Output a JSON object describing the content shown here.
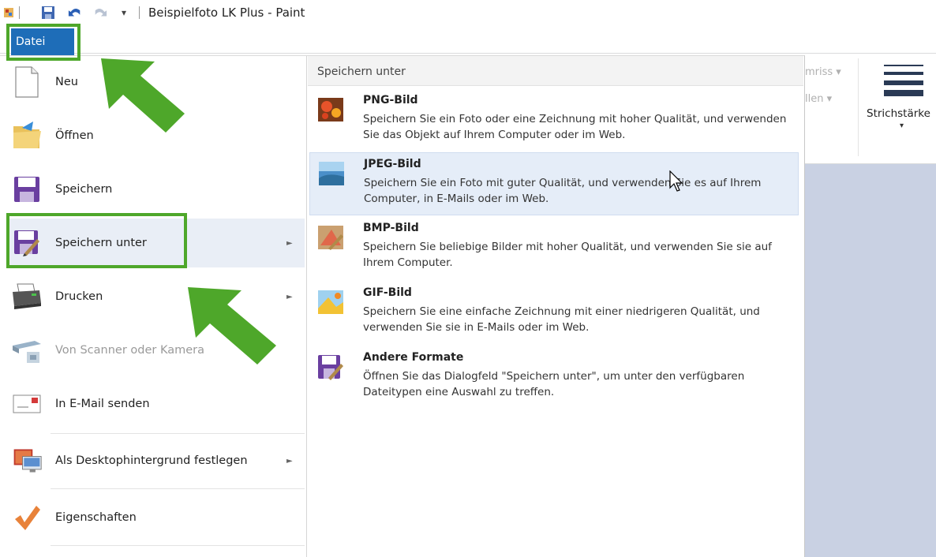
{
  "window": {
    "title": "Beispielfoto LK Plus - Paint"
  },
  "ribbon": {
    "tab_file": "Datei",
    "fragment_outline": "mriss",
    "fragment_fill": "llen",
    "stroke_width_label": "Strichstärke"
  },
  "file_menu": {
    "items": [
      {
        "label": "Neu",
        "icon": "new-page-icon"
      },
      {
        "label": "Öffnen",
        "icon": "open-folder-icon"
      },
      {
        "label": "Speichern",
        "icon": "save-disk-icon"
      },
      {
        "label": "Speichern unter",
        "icon": "save-as-icon",
        "has_submenu": true,
        "selected": true
      },
      {
        "label": "Drucken",
        "icon": "printer-icon",
        "has_submenu": true
      },
      {
        "label": "Von Scanner oder Kamera",
        "icon": "scanner-icon",
        "disabled": true
      },
      {
        "label": "In E-Mail senden",
        "icon": "email-icon"
      },
      {
        "label": "Als Desktophintergrund festlegen",
        "icon": "desktop-background-icon",
        "has_submenu": true
      },
      {
        "label": "Eigenschaften",
        "icon": "checkmark-icon"
      }
    ]
  },
  "submenu": {
    "header": "Speichern unter",
    "items": [
      {
        "title": "PNG-Bild",
        "description": "Speichern Sie ein Foto oder eine Zeichnung mit hoher Qualität, und verwenden Sie das Objekt auf Ihrem Computer oder im Web.",
        "icon": "png-image-icon"
      },
      {
        "title": "JPEG-Bild",
        "description": "Speichern Sie ein Foto mit guter Qualität, und verwenden Sie es auf Ihrem Computer, in E-Mails oder im Web.",
        "icon": "jpeg-image-icon",
        "hover": true
      },
      {
        "title": "BMP-Bild",
        "description": "Speichern Sie beliebige Bilder mit hoher Qualität, und verwenden Sie sie auf Ihrem Computer.",
        "icon": "bmp-image-icon"
      },
      {
        "title": "GIF-Bild",
        "description": "Speichern Sie eine einfache Zeichnung mit einer niedrigeren Qualität, und verwenden Sie sie in E-Mails oder im Web.",
        "icon": "gif-image-icon"
      },
      {
        "title": "Andere Formate",
        "description": "Öffnen Sie das Dialogfeld \"Speichern unter\", um unter den verfügbaren Dateitypen eine Auswahl zu treffen.",
        "icon": "other-formats-icon"
      }
    ]
  },
  "colors": {
    "accent": "#1e6db8",
    "highlight_green": "#4ea72a",
    "hover_bg": "#e5edf8"
  }
}
